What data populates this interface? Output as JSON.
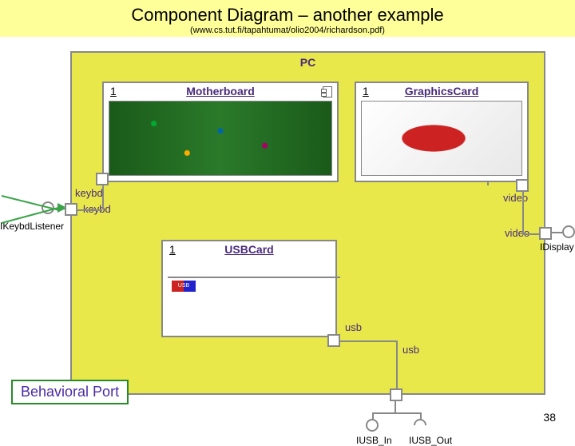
{
  "header": {
    "title": "Component Diagram – another example",
    "subtitle": "(www.cs.tut.fi/tapahtumat/olio2004/richardson.pdf)"
  },
  "container": {
    "name": "PC"
  },
  "components": {
    "motherboard": {
      "mult": "1",
      "name": "Motherboard"
    },
    "graphics": {
      "mult": "1",
      "name": "GraphicsCard"
    },
    "usbcard": {
      "mult": "1",
      "name": "USBCard"
    }
  },
  "port_labels": {
    "keybd1": "keybd",
    "keybd2": "keybd",
    "video1": "video",
    "video2": "video",
    "usb1": "usb",
    "usb2": "usb"
  },
  "interfaces": {
    "ikeybd": "IKeybdListener",
    "idisplay": "IDisplay",
    "iusb_in": "IUSB_In",
    "iusb_out": "IUSB_Out"
  },
  "callout": {
    "behavioral_port": "Behavioral Port"
  },
  "usb_logo": "USB",
  "page_number": "38"
}
